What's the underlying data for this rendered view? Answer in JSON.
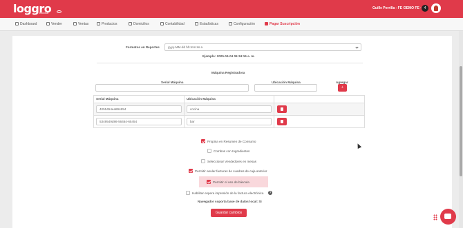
{
  "header": {
    "logo": "loggro",
    "logo_sub": "restobar",
    "user": "Guille Perrilla - FE ·",
    "company": "DEMO FE ·",
    "notifications": "4",
    "accent_color": "#e03a4a"
  },
  "nav": {
    "items": [
      {
        "label": "Dashboard",
        "icon": "dashboard-icon"
      },
      {
        "label": "Vender",
        "icon": "cart-icon"
      },
      {
        "label": "Ventas",
        "icon": "tag-icon"
      },
      {
        "label": "Productos",
        "icon": "box-icon"
      },
      {
        "label": "Domicilios",
        "icon": "bike-icon"
      },
      {
        "label": "Contabilidad",
        "icon": "calculator-icon"
      },
      {
        "label": "Estadísticas",
        "icon": "chart-icon"
      },
      {
        "label": "Configuración",
        "icon": "gear-icon"
      },
      {
        "label": "Pagar Suscripción",
        "icon": "card-icon",
        "active": true
      }
    ]
  },
  "form": {
    "report_format_label": "Formatos en Reportes",
    "report_format_value": "yyyy-MM-dd hh:mm:ss a",
    "report_format_example": "Ejemplo: 2025-04-04 06:34:16 a. m.",
    "machines_title": "Máquina Registradora",
    "serial_label": "Serial Máquina",
    "location_label": "Ubicación Máquina",
    "add_label": "Agregar",
    "add_button": "+",
    "table": {
      "headers": [
        "Serial Máquina",
        "Ubicación Máquina"
      ],
      "rows": [
        {
          "serial": "4055454ea894654",
          "location": "cocina"
        },
        {
          "serial": "5349549d86-56464-65454",
          "location": "bar"
        }
      ]
    },
    "options": [
      {
        "label": "Propina en Resumen de Consumo",
        "checked": true
      },
      {
        "label": "Combos con Ingredientes",
        "checked": false
      },
      {
        "label": "Seleccionar Vendedores en mesas",
        "checked": false
      },
      {
        "label": "Permitir anular facturas de cuadres de caja anterior",
        "checked": true
      },
      {
        "label": "Permitir el uso de báscula",
        "checked": true
      },
      {
        "label": "Habilitar espera impresión de la factura electrónica",
        "checked": false
      }
    ],
    "browser_note": "Navegador soporta base de datos local: Si",
    "save_button": "Guardar cambios"
  }
}
